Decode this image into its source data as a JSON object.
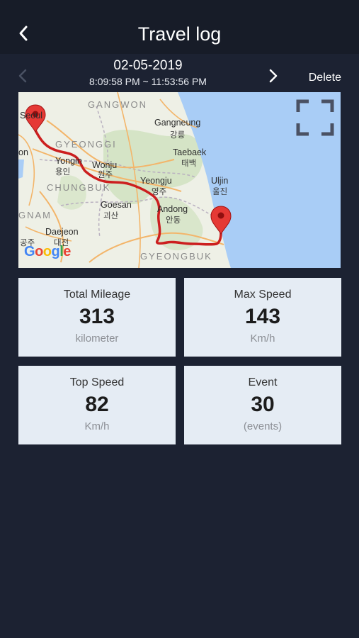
{
  "header": {
    "title": "Travel log",
    "back_icon": "chevron-left-icon"
  },
  "trip": {
    "date": "02-05-2019",
    "time_range": "8:09:58 PM ~ 11:53:56 PM",
    "prev_icon": "chevron-left-icon",
    "next_icon": "chevron-right-icon",
    "delete_label": "Delete"
  },
  "map": {
    "labels": {
      "gangwon": "GANGWON",
      "gyeonggi": "GYEONGGI",
      "chungbuk": "CHUNGBUK",
      "gyeongbuk": "GYEONGBUK",
      "gnam": "GNAM",
      "seoul": "Seoul",
      "on": "on",
      "gangneung": "Gangneung",
      "gangneung_kr": "강릉",
      "yongin": "Yongin",
      "yongin_kr": "용인",
      "wonju": "Wonju",
      "wonju_kr": "원주",
      "taebaek": "Taebaek",
      "taebaek_kr": "태백",
      "yeongju": "Yeongju",
      "yeongju_kr": "영주",
      "uljin": "Uljin",
      "uljin_kr": "울진",
      "goesan": "Goesan",
      "goesan_kr": "괴산",
      "andong": "Andong",
      "andong_kr": "안동",
      "daejeon": "Daejeon",
      "daejeon_kr": "대전",
      "gongju_kr": "공주",
      "google": "Google"
    },
    "route_color": "#cc1f1f",
    "pin_color": "#e53935",
    "sea_color": "#a9cdf6",
    "land_color": "#eef0e6"
  },
  "stats": [
    {
      "label": "Total Mileage",
      "value": "313",
      "unit": "kilometer"
    },
    {
      "label": "Max Speed",
      "value": "143",
      "unit": "Km/h"
    },
    {
      "label": "Top Speed",
      "value": "82",
      "unit": "Km/h"
    },
    {
      "label": "Event",
      "value": "30",
      "unit": "(events)"
    }
  ]
}
